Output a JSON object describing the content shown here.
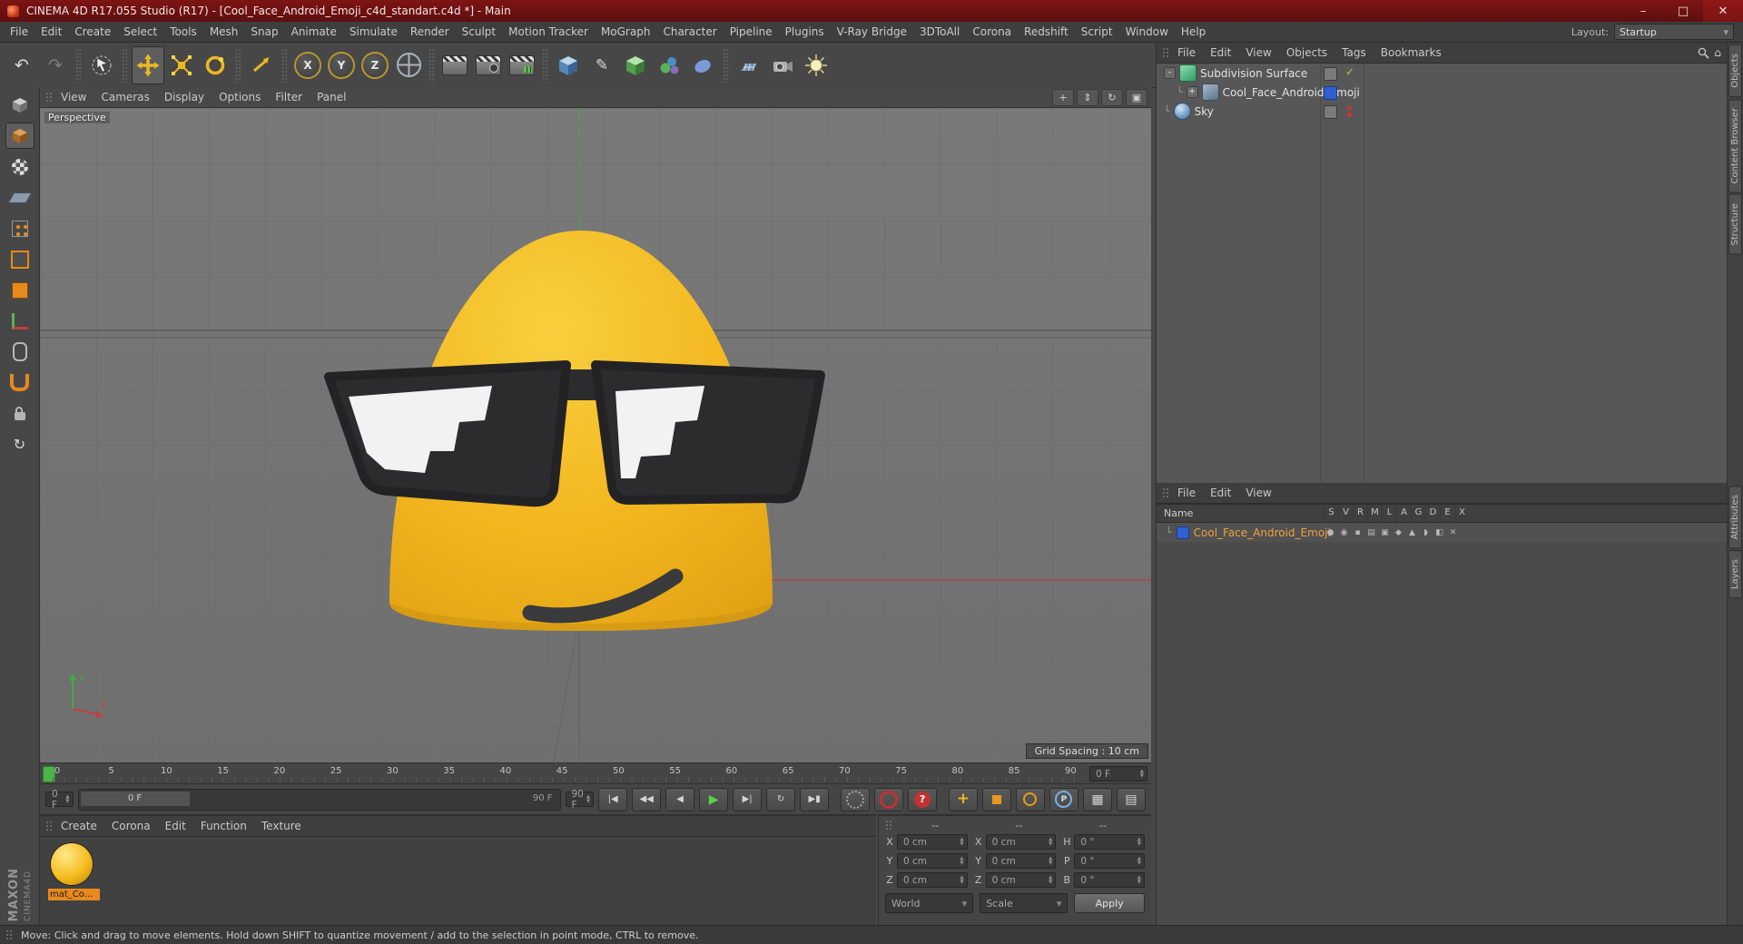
{
  "titlebar": {
    "title": "CINEMA 4D R17.055 Studio (R17) - [Cool_Face_Android_Emoji_c4d_standart.c4d *] - Main"
  },
  "window": {
    "minimize": "–",
    "maximize": "□",
    "close": "✕"
  },
  "menubar": {
    "items": [
      "File",
      "Edit",
      "Create",
      "Select",
      "Tools",
      "Mesh",
      "Snap",
      "Animate",
      "Simulate",
      "Render",
      "Sculpt",
      "Motion Tracker",
      "MoGraph",
      "Character",
      "Pipeline",
      "Plugins",
      "V-Ray Bridge",
      "3DToAll",
      "Corona",
      "Redshift",
      "Script",
      "Window",
      "Help"
    ],
    "layout_label": "Layout:",
    "layout_value": "Startup"
  },
  "glyphs": {
    "undo": "↶",
    "redo": "↷",
    "pen": "✎",
    "home": "⌂",
    "dropdown": "▾",
    "spin_up": "▲",
    "spin_down": "▼",
    "check": "✓",
    "expand_minus": "–",
    "expand_plus": "+",
    "elbow": "└",
    "pla_grid": "▦",
    "dopesheet": "▤",
    "quantize": "↻"
  },
  "toolbar": {
    "axis_x": "X",
    "axis_y": "Y",
    "axis_z": "Z"
  },
  "viewport": {
    "menu": [
      "View",
      "Cameras",
      "Display",
      "Options",
      "Filter",
      "Panel"
    ],
    "camera_label": "Perspective",
    "grid_spacing": "Grid Spacing : 10 cm",
    "controls": [
      {
        "name": "pan-view-icon",
        "glyph": "+"
      },
      {
        "name": "zoom-view-icon",
        "glyph": "⇕"
      },
      {
        "name": "rotate-view-icon",
        "glyph": "↻"
      },
      {
        "name": "toggle-view-icon",
        "glyph": "▣"
      }
    ],
    "axis_x_label": "X",
    "axis_y_label": "Y"
  },
  "object_manager": {
    "menu": [
      "File",
      "Edit",
      "View",
      "Objects",
      "Tags",
      "Bookmarks"
    ],
    "items": [
      {
        "label": "Subdivision Surface"
      },
      {
        "label": "Cool_Face_Android_Emoji"
      },
      {
        "label": "Sky"
      }
    ]
  },
  "layer_manager": {
    "menu": [
      "File",
      "Edit",
      "View"
    ],
    "name_header": "Name",
    "columns": [
      "S",
      "V",
      "R",
      "M",
      "L",
      "A",
      "G",
      "D",
      "E",
      "X"
    ],
    "row_label": "Cool_Face_Android_Emoji"
  },
  "right_tabs": {
    "top": [
      "Objects",
      "Content Browser",
      "Structure"
    ],
    "bottom": [
      "Attributes",
      "Layers"
    ]
  },
  "timeline": {
    "ticks": [
      "0",
      "5",
      "10",
      "15",
      "20",
      "25",
      "30",
      "35",
      "40",
      "45",
      "50",
      "55",
      "60",
      "65",
      "70",
      "75",
      "80",
      "85",
      "90"
    ],
    "frame_field": "0 F"
  },
  "transport": {
    "current": "0 F",
    "range_start": "0 F",
    "range_end": "90 F",
    "end_field": "90 F",
    "buttons": [
      {
        "name": "goto-start-button",
        "glyph": "|◀"
      },
      {
        "name": "play-backwards-button",
        "glyph": "◀◀"
      },
      {
        "name": "previous-frame-button",
        "glyph": "◀"
      },
      {
        "name": "play-forwards-button",
        "glyph": "▶"
      },
      {
        "name": "next-frame-button",
        "glyph": "▶|"
      },
      {
        "name": "cycle-button",
        "glyph": "↻"
      },
      {
        "name": "goto-end-button",
        "glyph": "▶▮"
      }
    ],
    "keyframe_selection_glyph": "?",
    "parameter_letter": "P"
  },
  "material_manager": {
    "menu": [
      "Create",
      "Corona",
      "Edit",
      "Function",
      "Texture"
    ],
    "material_label": "mat_Co..."
  },
  "coordinates": {
    "groups": [
      "--",
      "--",
      "--"
    ],
    "cells": [
      {
        "label": "X",
        "value": "0 cm"
      },
      {
        "label": "X",
        "value": "0 cm"
      },
      {
        "label": "H",
        "value": "0 °"
      },
      {
        "label": "Y",
        "value": "0 cm"
      },
      {
        "label": "Y",
        "value": "0 cm"
      },
      {
        "label": "P",
        "value": "0 °"
      },
      {
        "label": "Z",
        "value": "0 cm"
      },
      {
        "label": "Z",
        "value": "0 cm"
      },
      {
        "label": "B",
        "value": "0 °"
      }
    ],
    "space": "World",
    "scale_mode": "Scale",
    "apply": "Apply"
  },
  "statusbar": {
    "text": "Move: Click and drag to move elements. Hold down SHIFT to quantize movement / add to the selection in point mode, CTRL to remove."
  },
  "brand": {
    "maxon": "MAXON",
    "cinema": "CINEMA4D"
  },
  "colors": {
    "titlebar": "#6b1010",
    "accent_orange": "#e8891c",
    "tool_yellow": "#edb821",
    "emoji_yellow": "#f2b51e",
    "viewport_bg": "#747474",
    "play_green": "#5ad042",
    "object_text_orange": "#f0a23c",
    "tag_blue": "#2f5fd0"
  }
}
